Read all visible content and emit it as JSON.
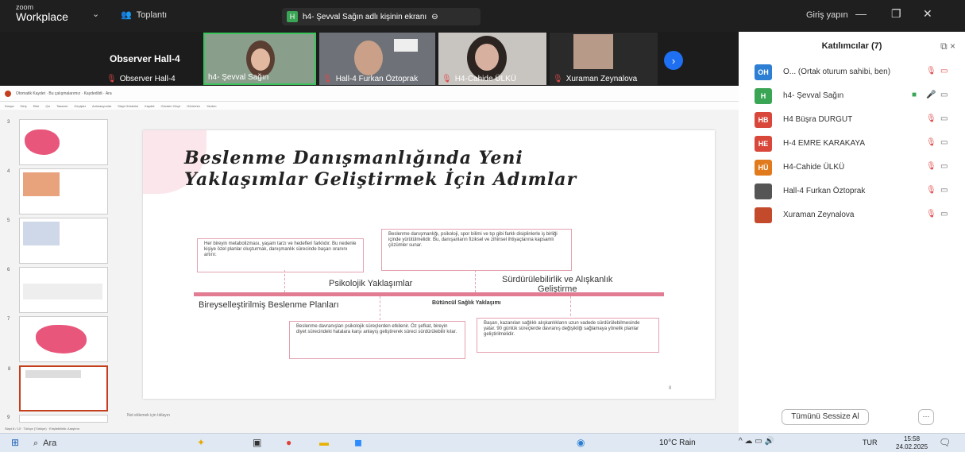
{
  "app": {
    "logo_top": "zoom",
    "logo_bottom": "Workplace",
    "meeting": "Toplantı",
    "share_status": "h4- Şevval Sağın adlı kişinin ekranı",
    "login": "Giriş yapın"
  },
  "gallery": {
    "observer_name": "Observer Hall-4",
    "observer_label": "Observer Hall-4",
    "tiles": [
      {
        "label": "h4- Şevval Sağın"
      },
      {
        "label": "Hall-4 Furkan Öztoprak"
      },
      {
        "label": "H4-Cahide ÜLKÜ"
      },
      {
        "label": "Xuraman Zeynalova"
      }
    ]
  },
  "ppt": {
    "toolbar_text": "Otomatik Kaydet · Bu çalışmalarımız · Kaydedildi · Ara",
    "menu": [
      "Dosya",
      "Giriş",
      "Ekle",
      "Çiz",
      "Tasarım",
      "Geçişler",
      "Animasyonlar",
      "Slayt Gösterisi",
      "Kaydet",
      "Gözden Geçir",
      "Görünüm",
      "Yardım"
    ],
    "thumbs": [
      "3",
      "4",
      "5",
      "6",
      "7",
      "8",
      "9"
    ],
    "notes": "Not eklemek için tıklayın",
    "status": "Slayt 8 / 10 · Türkçe (Türkiye) · Erişilebilirlik: Araştırın"
  },
  "slide": {
    "title1": "Beslenme Danışmanlığında Yeni",
    "title2": "Yaklaşımlar Geliştirmek İçin Adımlar",
    "box1": "Her bireyin metabolizması, yaşam tarzı ve hedefleri farklıdır. Bu nedenle kişiye özel planlar oluşturmak, danışmanlık sürecinde başarı oranını artırır.",
    "box2": "Beslenme danışmanlığı, psikoloji, spor bilimi ve tıp gibi farklı disiplinlerle iş birliği içinde yürütülmelidir. Bu, danışanların fiziksel ve zihinsel ihtiyaçlarına kapsamlı çözümler sunar.",
    "box3": "Beslenme davranışları psikolojik süreçlerden etkilenir. Öz şefkat, bireyin diyet sürecindeki hatalara karşı anlayış geliştirerek süreci sürdürülebilir kılar.",
    "box4": "Başarı, kazanılan sağlıklı alışkanlıkların uzun vadede sürdürülebilmesinde yatar. 90 günlük süreçlerde davranış değişikliği sağlamaya yönelik planlar geliştirilmelidir.",
    "label_psych": "Psikolojik Yaklaşımlar",
    "label_sustain1": "Sürdürülebilirlik ve Alışkanlık",
    "label_sustain2": "Geliştirme",
    "label_personal": "Bireyselleştirilmiş Beslenme Planları",
    "label_holistic": "Bütüncül Sağlık Yaklaşımı",
    "page_num": "8"
  },
  "participants": {
    "header": "Katılımcılar (7)",
    "list": [
      {
        "initials": "OH",
        "color": "#2d7fd4",
        "name": "O... (Ortak oturum sahibi, ben)"
      },
      {
        "initials": "H",
        "color": "#3aa655",
        "name": "h4- Şevval Sağın"
      },
      {
        "initials": "HB",
        "color": "#d9473b",
        "name": "H4 Büşra DURGUT"
      },
      {
        "initials": "HE",
        "color": "#d9473b",
        "name": "H-4 EMRE KARAKAYA"
      },
      {
        "initials": "HÜ",
        "color": "#e07a1c",
        "name": "H4-Cahide ÜLKÜ"
      },
      {
        "initials": "",
        "color": "#555555",
        "name": "Hall-4 Furkan Öztoprak"
      },
      {
        "initials": "",
        "color": "#c44a2c",
        "name": "Xuraman Zeynalova"
      }
    ],
    "mute_all": "Tümünü Sessize Al",
    "more": "···"
  },
  "taskbar": {
    "search": "Ara",
    "weather": "10°C Rain",
    "lang": "TUR",
    "time": "15:58",
    "date": "24.02.2025"
  }
}
